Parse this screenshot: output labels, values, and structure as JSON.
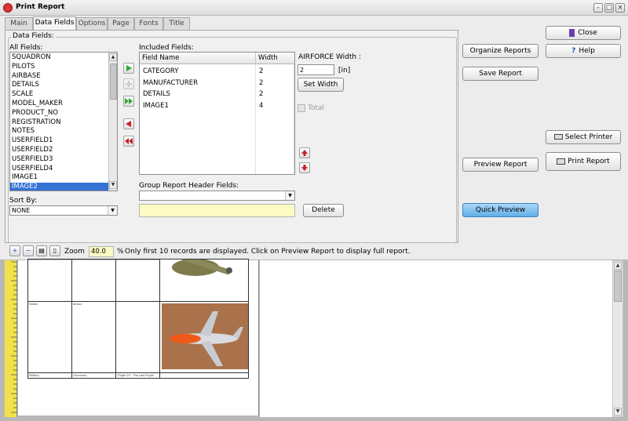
{
  "window": {
    "title": "Print Report",
    "controls": [
      "-",
      "□",
      "×"
    ]
  },
  "tabs": [
    "Main",
    "Data Fields",
    "Options",
    "Page",
    "Fonts",
    "Title"
  ],
  "active_tab": "Data Fields",
  "data_fields": {
    "group_label": "Data Fields:",
    "all_fields_label": "All Fields:",
    "all_fields": [
      "SQUADRON",
      "PILOTS",
      "AIRBASE",
      "DETAILS",
      "SCALE",
      "MODEL_MAKER",
      "PRODUCT_NO",
      "REGISTRATION",
      "NOTES",
      "USERFIELD1",
      "USERFIELD2",
      "USERFIELD3",
      "USERFIELD4",
      "IMAGE1",
      "IMAGE2"
    ],
    "selected_field": "IMAGE2",
    "sort_by_label": "Sort By:",
    "sort_by_value": "NONE",
    "included_label": "Included Fields:",
    "columns": [
      "Field Name",
      "Width"
    ],
    "included_fields": [
      {
        "name": "CATEGORY",
        "width": "2"
      },
      {
        "name": "MANUFACTURER",
        "width": "2"
      },
      {
        "name": "DETAILS",
        "width": "2"
      },
      {
        "name": "IMAGE1",
        "width": "4"
      }
    ],
    "width_label": "AIRFORCE Width :",
    "width_value": "2",
    "width_unit": "[in]",
    "set_width": "Set Width",
    "total_label": "Total",
    "group_header_label": "Group Report Header Fields:",
    "delete": "Delete"
  },
  "actions": {
    "organize": "Organize Reports",
    "save": "Save Report",
    "preview": "Preview Report",
    "quick_preview": "Quick Preview",
    "close": "Close",
    "help": "Help",
    "select_printer": "Select Printer",
    "print_report": "Print Report"
  },
  "toolbar": {
    "zoom_label": "Zoom",
    "zoom_value": "40.0",
    "percent": "%",
    "message": "Only first 10 records are displayed. Click on Preview Report to display full report."
  },
  "preview": {
    "row1": [
      "Dallas",
      "Airbus"
    ],
    "row2": [
      "Military",
      "Grumman",
      "\"Flight 19 - The Lost Flight\""
    ]
  },
  "colors": {
    "selection": "#3472d4",
    "quick_preview": "#7fbfee",
    "ruler": "#f2e24a",
    "arrow_green": "#2fa82f",
    "arrow_red": "#c8202a"
  }
}
